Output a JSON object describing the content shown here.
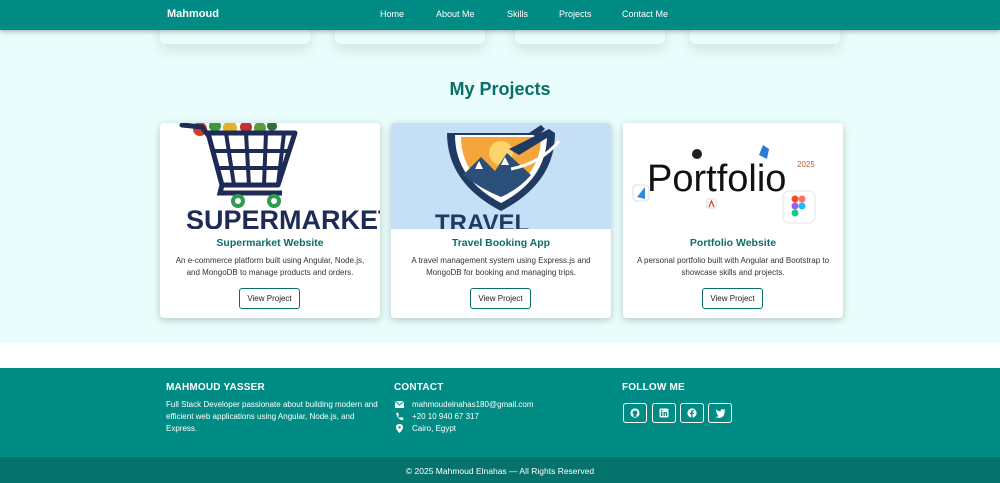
{
  "navbar": {
    "brand": "Mahmoud",
    "links": [
      "Home",
      "About Me",
      "Skills",
      "Projects",
      "Contact Me"
    ]
  },
  "projects": {
    "title": "My Projects",
    "cards": [
      {
        "title": "Supermarket Website",
        "description": "An e-commerce platform built using Angular, Node.js, and MongoDB to manage products and orders.",
        "button": "View Project",
        "image_text": "SUPERMARKET"
      },
      {
        "title": "Travel Booking App",
        "description": "A travel management system using Express.js and MongoDB for booking and managing trips.",
        "button": "View Project",
        "image_text": "TRAVEL"
      },
      {
        "title": "Portfolio Website",
        "description": "A personal portfolio built with Angular and Bootstrap to showcase skills and projects.",
        "button": "View Project",
        "image_text": "Portfolio",
        "image_year": "2025"
      }
    ]
  },
  "footer": {
    "about": {
      "heading": "MAHMOUD YASSER",
      "text": "Full Stack Developer passionate about building modern and efficient web applications using Angular, Node.js, and Express."
    },
    "contact": {
      "heading": "CONTACT",
      "email": "mahmoudelnahas180@gmail.com",
      "phone": "+20 10 940 67 317",
      "location": "Cairo, Egypt"
    },
    "follow": {
      "heading": "FOLLOW ME",
      "icons": [
        "github-icon",
        "linkedin-icon",
        "facebook-icon",
        "twitter-icon"
      ]
    },
    "copyright": "© 2025 Mahmoud Elnahas — All Rights Reserved"
  },
  "colors": {
    "primary": "#008b84",
    "dark": "#06726c",
    "title": "#0b6e68",
    "section_bg": "#e9fdfc"
  }
}
